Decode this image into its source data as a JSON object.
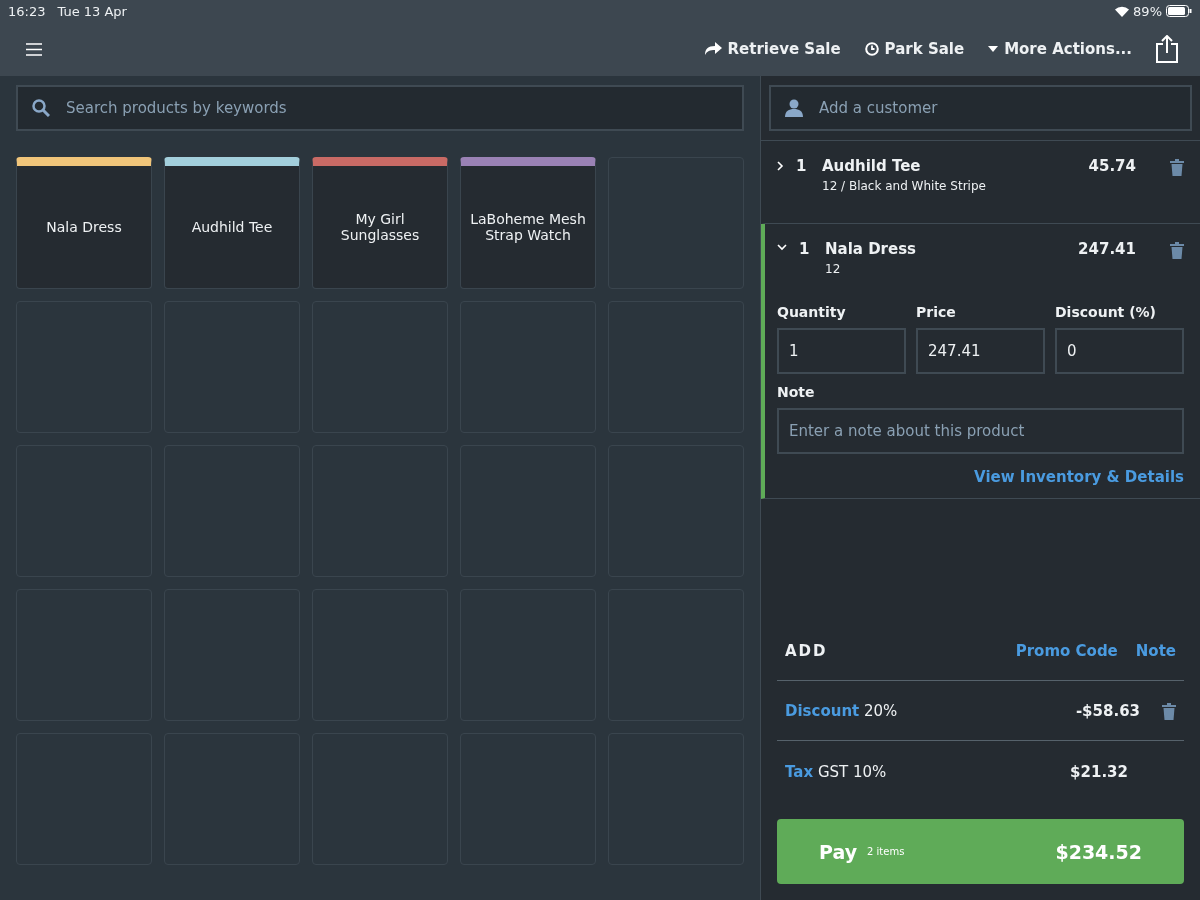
{
  "status_bar": {
    "time": "16:23",
    "date": "Tue 13 Apr",
    "battery": "89%"
  },
  "toolbar": {
    "actions": [
      {
        "kind": "retrieve",
        "label": "Retrieve Sale"
      },
      {
        "kind": "park",
        "label": "Park Sale"
      },
      {
        "kind": "more",
        "label": "More Actions..."
      }
    ]
  },
  "search": {
    "placeholder": "Search products by keywords"
  },
  "tiles": [
    {
      "kind": "product",
      "label": "Nala Dress",
      "color": "#f0c57a"
    },
    {
      "kind": "product",
      "label": "Audhild Tee",
      "color": "#a3cfdc"
    },
    {
      "kind": "product",
      "label": "My Girl Sunglasses",
      "color": "#c96a65"
    },
    {
      "kind": "product",
      "label": "LaBoheme Mesh Strap Watch",
      "color": "#9a82b5"
    },
    {
      "kind": "empty"
    },
    {
      "kind": "empty"
    },
    {
      "kind": "empty"
    },
    {
      "kind": "empty"
    },
    {
      "kind": "empty"
    },
    {
      "kind": "empty"
    },
    {
      "kind": "empty"
    },
    {
      "kind": "empty"
    },
    {
      "kind": "empty"
    },
    {
      "kind": "empty"
    },
    {
      "kind": "empty"
    },
    {
      "kind": "empty"
    },
    {
      "kind": "empty"
    },
    {
      "kind": "empty"
    },
    {
      "kind": "empty"
    },
    {
      "kind": "empty"
    },
    {
      "kind": "empty"
    },
    {
      "kind": "empty"
    },
    {
      "kind": "empty"
    },
    {
      "kind": "empty"
    },
    {
      "kind": "empty"
    }
  ],
  "customer": {
    "placeholder": "Add a customer"
  },
  "cart": [
    {
      "qty": "1",
      "name": "Audhild Tee",
      "variant": "12 / Black and White Stripe",
      "price": "45.74",
      "expanded": false
    },
    {
      "qty": "1",
      "name": "Nala Dress",
      "variant": "12",
      "price": "247.41",
      "expanded": true,
      "fields": [
        {
          "label": "Quantity",
          "value": "1"
        },
        {
          "label": "Price",
          "value": "247.41"
        },
        {
          "label": "Discount (%)",
          "value": "0"
        }
      ],
      "note": {
        "label": "Note",
        "placeholder": "Enter a note about this product"
      },
      "link": "View Inventory & Details"
    }
  ],
  "add": {
    "title": "ADD",
    "links": [
      "Promo Code",
      "Note"
    ]
  },
  "adjustments": [
    {
      "label": "Discount",
      "detail": "20%",
      "amount": "-$58.63",
      "removable": true
    },
    {
      "label": "Tax",
      "detail": "GST 10%",
      "amount": "$21.32",
      "removable": false
    }
  ],
  "pay": {
    "label": "Pay",
    "items": "2 items",
    "total": "$234.52"
  }
}
